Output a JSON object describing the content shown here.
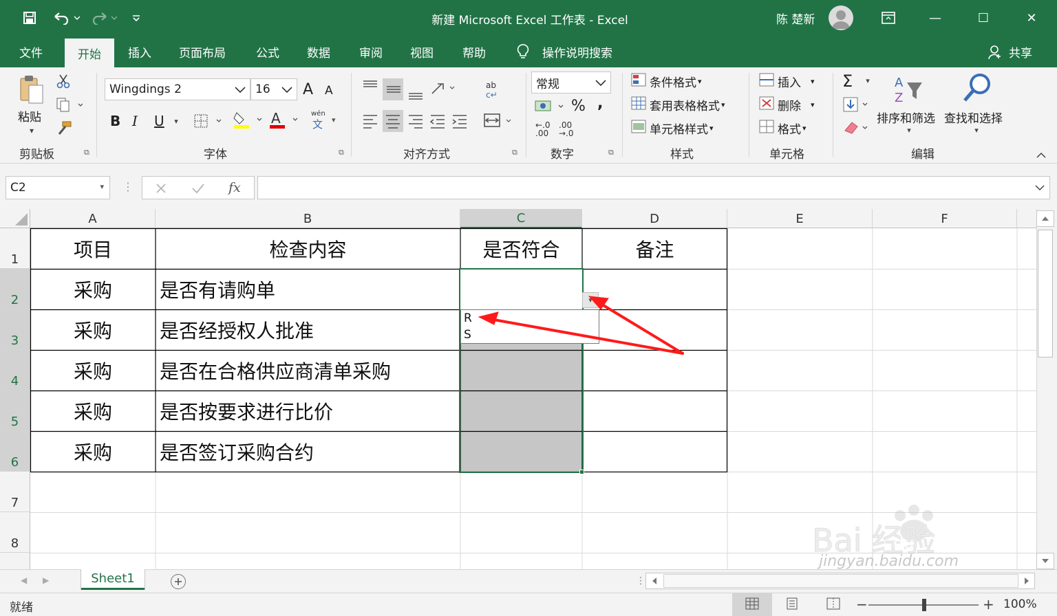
{
  "window": {
    "title": "新建 Microsoft Excel 工作表  -  Excel",
    "user": "陈 楚新",
    "qat": {
      "save_icon": "save-icon",
      "undo_icon": "undo-icon",
      "redo_icon": "redo-icon",
      "customize_icon": "customize-icon"
    },
    "controls": {
      "minimize": "—",
      "restore": "☐",
      "close": "✕"
    },
    "accent": "#217346"
  },
  "tabs": [
    "文件",
    "开始",
    "插入",
    "页面布局",
    "公式",
    "数据",
    "审阅",
    "视图",
    "帮助"
  ],
  "active_tab": "开始",
  "tell_me": "操作说明搜索",
  "share": "共享",
  "ribbon": {
    "clipboard": {
      "label": "剪贴板",
      "paste": "粘贴"
    },
    "font": {
      "label": "字体",
      "font_name": "Wingdings 2",
      "font_size": "16",
      "bold": "B",
      "italic": "I",
      "underline": "U",
      "grow": "A",
      "shrink": "A",
      "wen": "wén",
      "wen_char": "文"
    },
    "alignment": {
      "label": "对齐方式"
    },
    "number": {
      "label": "数字",
      "format": "常规",
      "percent": "%",
      "comma": ",",
      "inc_decimal": "←.0\n.00",
      "dec_decimal": ".00\n→.0"
    },
    "styles": {
      "label": "样式",
      "conditional": "条件格式",
      "table": "套用表格格式",
      "cell_styles": "单元格样式"
    },
    "cells": {
      "label": "单元格",
      "insert": "插入",
      "delete": "删除",
      "format": "格式"
    },
    "editing": {
      "label": "编辑",
      "sort": "排序和筛选",
      "find": "查找和选择",
      "sum": "Σ"
    }
  },
  "formula_bar": {
    "name_box": "C2",
    "fx": "fx",
    "content": ""
  },
  "columns": [
    "A",
    "B",
    "C",
    "D",
    "E",
    "F"
  ],
  "selected_column": "C",
  "rows": [
    "1",
    "2",
    "3",
    "4",
    "5",
    "6",
    "7",
    "8"
  ],
  "table": {
    "header": [
      "项目",
      "检查内容",
      "是否符合",
      "备注"
    ],
    "data": [
      [
        "采购",
        "是否有请购单",
        "",
        ""
      ],
      [
        "采购",
        "是否经授权人批准",
        "",
        ""
      ],
      [
        "采购",
        "是否在合格供应商清单采购",
        "",
        ""
      ],
      [
        "采购",
        "是否按要求进行比价",
        "",
        ""
      ],
      [
        "采购",
        "是否签订采购合约",
        "",
        ""
      ]
    ]
  },
  "dropdown": {
    "options": [
      "R",
      "S"
    ]
  },
  "sheets": [
    "Sheet1"
  ],
  "status": {
    "ready": "就绪",
    "zoom": "100%"
  },
  "watermark": {
    "brand": "Baidu经验",
    "url": "jingyan.baidu.com"
  }
}
